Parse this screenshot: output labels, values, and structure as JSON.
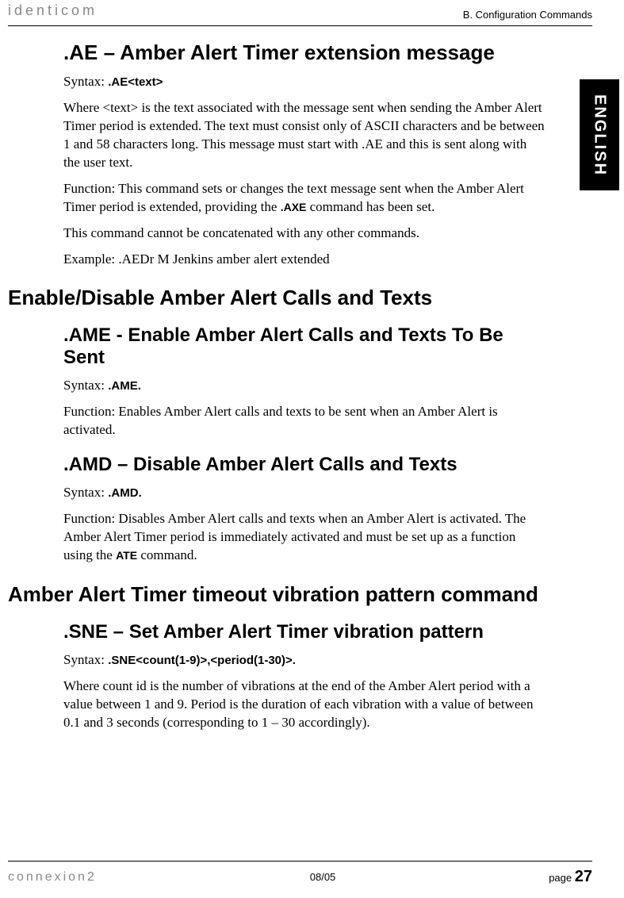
{
  "header": {
    "logo": "identicom",
    "title": "B. Configuration Commands"
  },
  "sideTab": "ENGLISH",
  "sections": {
    "ae": {
      "heading": ".AE – Amber Alert Timer extension message",
      "syntaxLabel": "Syntax: ",
      "syntaxCode": ".AE<text>",
      "p1a": "Where <text> is the text associated with the message sent when sending the Amber Alert Timer period is extended. The text must consist only of ASCII characters and be between 1 and 58 characters long. This message must start with .AE and this is sent along with the user text.",
      "p2a": "Function: This command sets or changes the text message sent when the Amber Alert Timer period is extended, providing the ",
      "p2code": ".AXE",
      "p2b": " command has been set.",
      "p3": "This command cannot be concatenated with any other commands.",
      "p4": "Example: .AEDr M Jenkins amber alert extended"
    },
    "enableDisable": {
      "heading": "Enable/Disable Amber Alert Calls and Texts",
      "ame": {
        "heading": ".AME - Enable Amber Alert Calls and Texts To Be Sent",
        "syntaxLabel": "Syntax: ",
        "syntaxCode": ".AME.",
        "p1": "Function: Enables Amber Alert calls and texts to be sent when an Amber Alert is activated."
      },
      "amd": {
        "heading": ".AMD – Disable Amber Alert Calls and Texts",
        "syntaxLabel": "Syntax: ",
        "syntaxCode": ".AMD.",
        "p1a": "Function: Disables Amber Alert calls and texts when an Amber Alert is activated. The Amber Alert Timer period is immediately activated and must be set up as a function using the ",
        "p1code": "ATE",
        "p1b": " command."
      }
    },
    "vibration": {
      "heading": "Amber Alert Timer timeout vibration pattern command",
      "sne": {
        "heading": ".SNE – Set Amber Alert Timer vibration pattern",
        "syntaxLabel": "Syntax: ",
        "syntaxCode": ".SNE<count(1-9)>,<period(1-30)>.",
        "p1": "Where count id is the number of vibrations at the end of the Amber Alert period with a value between 1 and 9. Period is the duration of each vibration with a value of between 0.1 and 3 seconds (corresponding to 1 – 30 accordingly)."
      }
    }
  },
  "footer": {
    "logo": "connexion2",
    "date": "08/05",
    "pageLabel": "page ",
    "pageNum": "27"
  }
}
